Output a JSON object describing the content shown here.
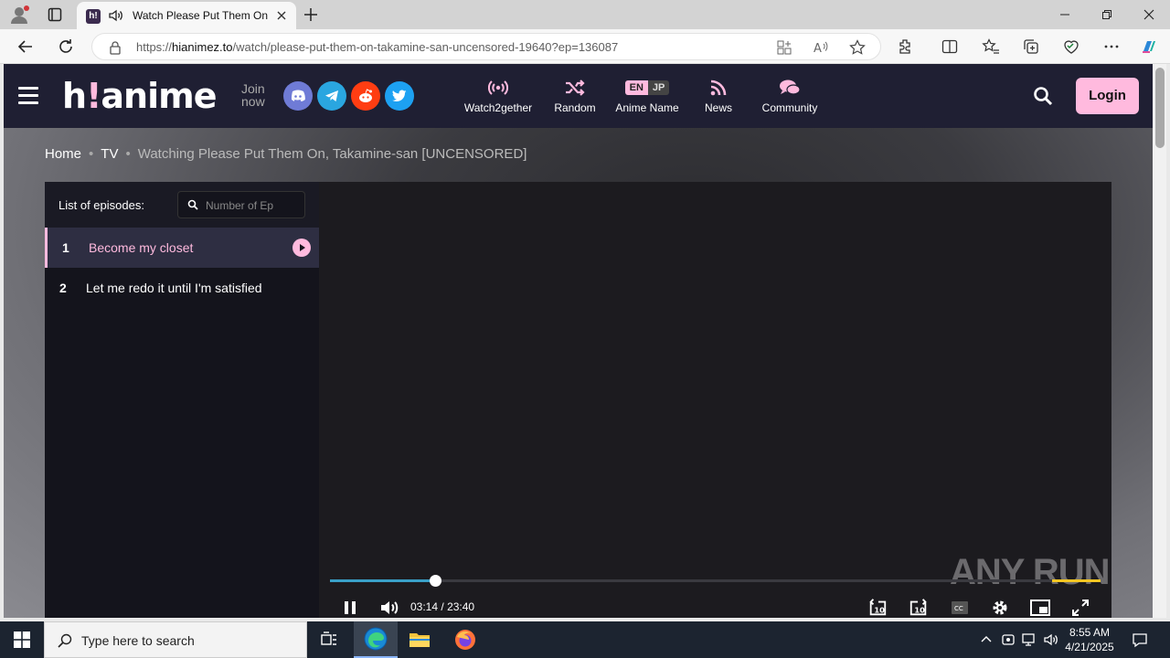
{
  "browser": {
    "tab_title": "Watch Please Put Them On, Takamine-san [UNCENSORED]",
    "favicon_text": "h!",
    "url_prefix": "https://",
    "url_domain": "hianimez.to",
    "url_path": "/watch/please-put-them-on-takamine-san-uncensored-19640?ep=136087"
  },
  "header": {
    "logo_main": "h",
    "logo_bang": "!",
    "logo_rest": "anime",
    "join_now": "Join now",
    "nav": [
      {
        "label": "Watch2gether",
        "icon": "broadcast-icon"
      },
      {
        "label": "Random",
        "icon": "shuffle-icon"
      },
      {
        "label": "Anime Name",
        "icon": "language-toggle"
      },
      {
        "label": "News",
        "icon": "rss-icon"
      },
      {
        "label": "Community",
        "icon": "chat-icon"
      }
    ],
    "lang_en": "EN",
    "lang_jp": "JP",
    "login": "Login"
  },
  "breadcrumb": {
    "home": "Home",
    "category": "TV",
    "current": "Watching Please Put Them On, Takamine-san [UNCENSORED]"
  },
  "episodes": {
    "label": "List of episodes:",
    "search_placeholder": "Number of Ep",
    "items": [
      {
        "number": "1",
        "title": "Become my closet",
        "active": true
      },
      {
        "number": "2",
        "title": "Let me redo it until I'm satisfied",
        "active": false
      }
    ]
  },
  "player": {
    "current_time": "03:14",
    "separator": "/",
    "duration": "23:40",
    "progress_fraction": 0.137,
    "watermark": "ANY RUN"
  },
  "taskbar": {
    "search_placeholder": "Type here to search",
    "time": "8:55 AM",
    "date": "4/21/2025"
  },
  "colors": {
    "accent_pink": "#ffbade",
    "header_bg": "#1f1f33",
    "progress_blue": "#3aa0c8"
  }
}
